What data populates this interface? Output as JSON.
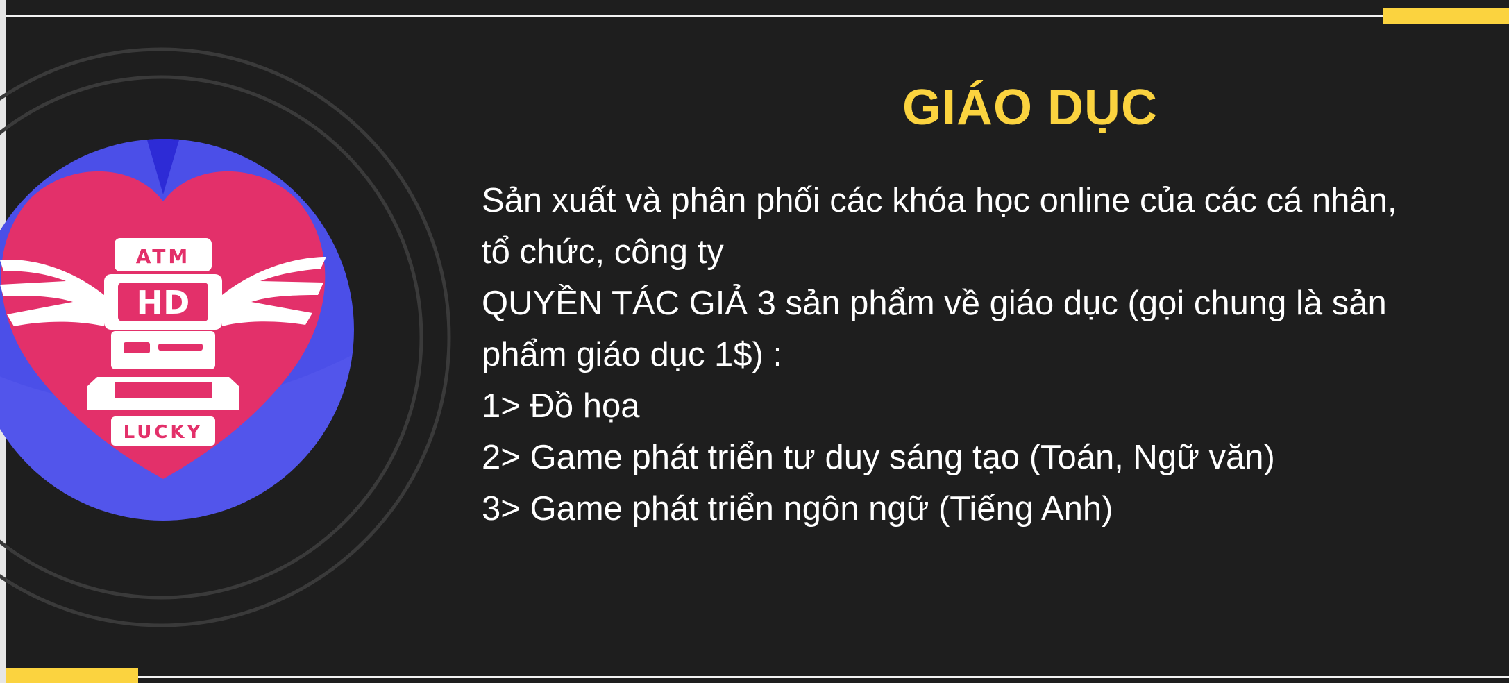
{
  "colors": {
    "background": "#1e1e1e",
    "accent": "#fbd33f",
    "text": "#ffffff",
    "logo_circle": "#4a4ae6",
    "logo_heart": "#e3306a"
  },
  "logo": {
    "top_text": "ATM",
    "center_text": "HD",
    "bottom_text": "LUCKY"
  },
  "title": "GIÁO DỤC",
  "lines": [
    "Sản xuất và phân phối các khóa học online  của các cá nhân,",
    "tổ chức, công ty",
    "QUYỀN TÁC GIẢ 3 sản phẩm về giáo dục (gọi chung là sản",
    "phẩm giáo dục 1$) :",
    "1> Đồ họa",
    "2> Game phát triển tư duy sáng tạo (Toán, Ngữ văn)",
    "3> Game phát triển ngôn ngữ (Tiếng Anh)"
  ]
}
